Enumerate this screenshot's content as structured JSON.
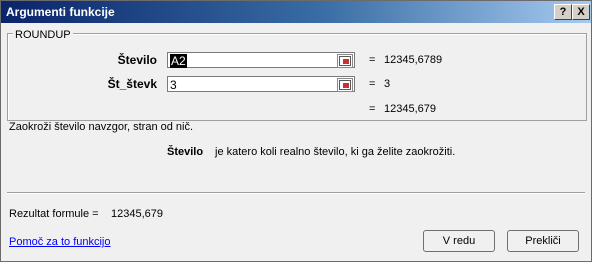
{
  "window": {
    "title": "Argumenti funkcije",
    "help_btn": "?",
    "close_btn": "X"
  },
  "function_name": "ROUNDUP",
  "args": [
    {
      "label": "Število",
      "value": "A2",
      "equals": "=",
      "result": "12345,6789"
    },
    {
      "label": "Št_števk",
      "value": "3",
      "equals": "=",
      "result": "3"
    }
  ],
  "function_result": {
    "equals": "=",
    "value": "12345,679"
  },
  "description": "Zaokroži število navzgor, stran od nič.",
  "arg_description": {
    "name": "Število",
    "text": "je katero koli realno število, ki ga želite zaokrožiti."
  },
  "formula_result": {
    "label": "Rezultat formule =",
    "value": "12345,679"
  },
  "help_link": "Pomoč za to funkcijo",
  "buttons": {
    "ok": "V redu",
    "cancel": "Prekliči"
  }
}
